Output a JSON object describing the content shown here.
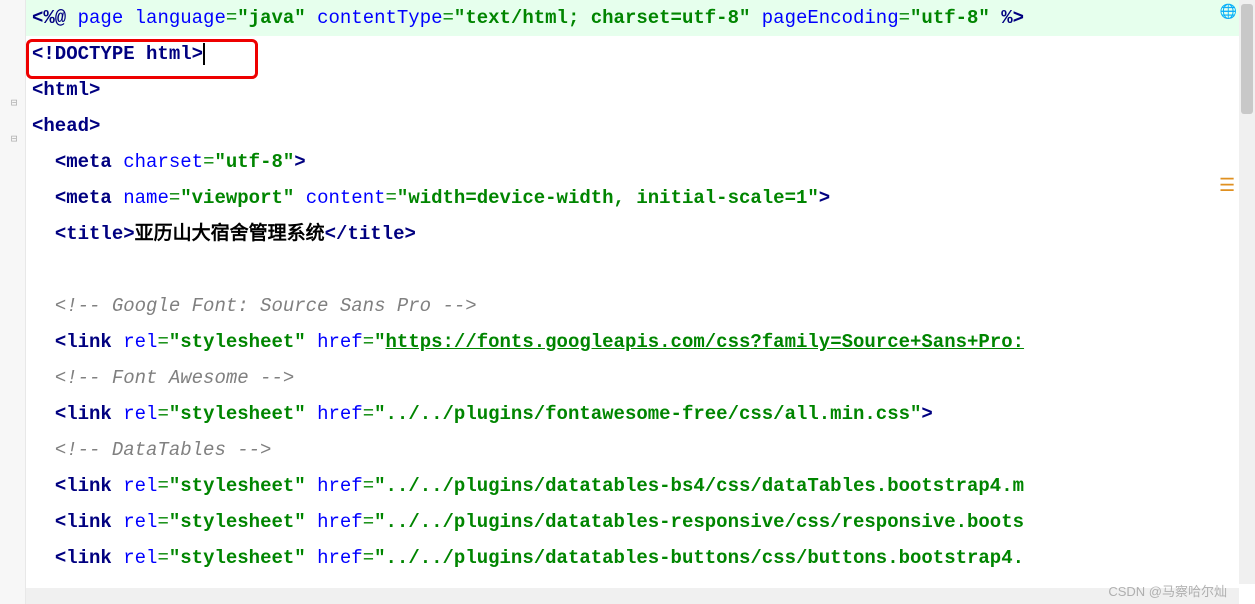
{
  "line1": {
    "jsp_open": "<%@",
    "page": "page",
    "lang_attr": "language",
    "lang_val": "\"java\"",
    "ct_attr": "contentType",
    "ct_val": "\"text/html; charset=utf-8\"",
    "pe_attr": "pageEncoding",
    "pe_val": "\"utf-8\"",
    "jsp_close": "%>"
  },
  "line2": {
    "doctype_open": "<!DOCTYPE",
    "html_kw": "html",
    "close": ">"
  },
  "line3": {
    "open": "<",
    "tag": "html",
    "close": ">"
  },
  "line4": {
    "open": "<",
    "tag": "head",
    "close": ">"
  },
  "line5": {
    "open": "<",
    "meta": "meta",
    "attr": "charset",
    "val": "\"utf-8\"",
    "close": ">"
  },
  "line6": {
    "open": "<",
    "meta": "meta",
    "name_attr": "name",
    "name_val": "\"viewport\"",
    "content_attr": "content",
    "content_val": "\"width=device-width, initial-scale=1\"",
    "close": ">"
  },
  "line7": {
    "open": "<",
    "title": "title",
    "gt": ">",
    "text": "亚历山大宿舍管理系统",
    "close_open": "</",
    "close": ">"
  },
  "line8": "",
  "line9": {
    "comment": "<!-- Google Font: Source Sans Pro -->"
  },
  "line10": {
    "open": "<",
    "link": "link",
    "rel_attr": "rel",
    "rel_val": "\"stylesheet\"",
    "href_attr": "href",
    "href_q": "\"",
    "href_url": "https://fonts.googleapis.com/css?family=Source+Sans+Pro:"
  },
  "line11": {
    "comment": "<!-- Font Awesome -->"
  },
  "line12": {
    "open": "<",
    "link": "link",
    "rel_attr": "rel",
    "rel_val": "\"stylesheet\"",
    "href_attr": "href",
    "href_val": "\"../../plugins/fontawesome-free/css/all.min.css\"",
    "close": ">"
  },
  "line13": {
    "comment": "<!-- DataTables -->"
  },
  "line14": {
    "open": "<",
    "link": "link",
    "rel_attr": "rel",
    "rel_val": "\"stylesheet\"",
    "href_attr": "href",
    "href_val": "\"../../plugins/datatables-bs4/css/dataTables.bootstrap4.m"
  },
  "line15": {
    "open": "<",
    "link": "link",
    "rel_attr": "rel",
    "rel_val": "\"stylesheet\"",
    "href_attr": "href",
    "href_val": "\"../../plugins/datatables-responsive/css/responsive.boots"
  },
  "line16": {
    "open": "<",
    "link": "link",
    "rel_attr": "rel",
    "rel_val": "\"stylesheet\"",
    "href_attr": "href",
    "href_val": "\"../../plugins/datatables-buttons/css/buttons.bootstrap4."
  },
  "watermark": "CSDN @马察哈尔灿"
}
